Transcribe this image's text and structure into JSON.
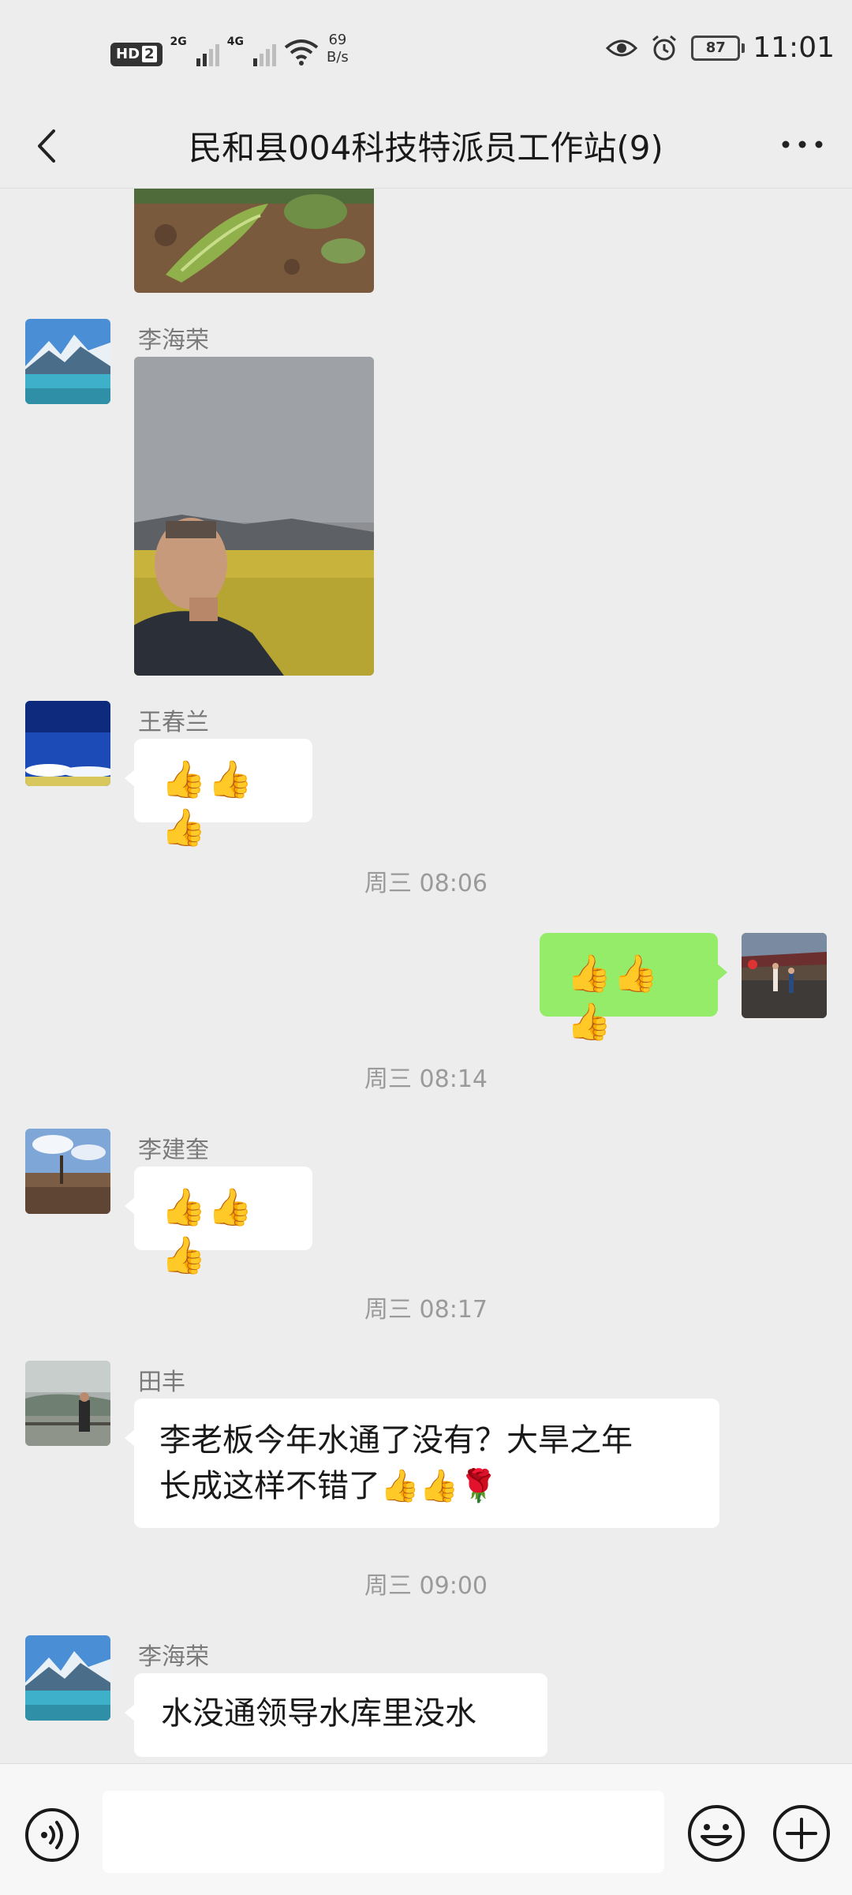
{
  "status_bar": {
    "hd_label": "HD",
    "hd_sim": "2",
    "net_1": "2G",
    "net_2": "4G",
    "speed_value": "69",
    "speed_unit": "B/s",
    "battery": "87",
    "time": "11:01"
  },
  "header": {
    "title": "民和县004科技特派员工作站(9)"
  },
  "messages": {
    "m1_sender": "李海荣",
    "m2_sender": "王春兰",
    "m2_text": "👍👍👍",
    "t1": "周三 08:06",
    "m3_text": "👍👍👍",
    "t2": "周三 08:14",
    "m4_sender": "李建奎",
    "m4_text": "👍👍👍",
    "t3": "周三 08:17",
    "m5_sender": "田丰",
    "m5_line1": "李老板今年水通了没有？大旱之年",
    "m5_line2": "长成这样不错了👍👍🌹",
    "t4": "周三 09:00",
    "m6_sender": "李海荣",
    "m6_text": "水没通领导水库里没水"
  },
  "input_bar": {
    "placeholder": ""
  },
  "colors": {
    "background": "#ededed",
    "my_bubble": "#95ec69",
    "other_bubble": "#ffffff"
  },
  "icons": [
    "back-arrow-icon",
    "more-icon",
    "voice-icon",
    "emoji-icon",
    "plus-icon",
    "eye-icon",
    "alarm-icon",
    "wifi-icon",
    "signal-icon",
    "battery-icon"
  ]
}
